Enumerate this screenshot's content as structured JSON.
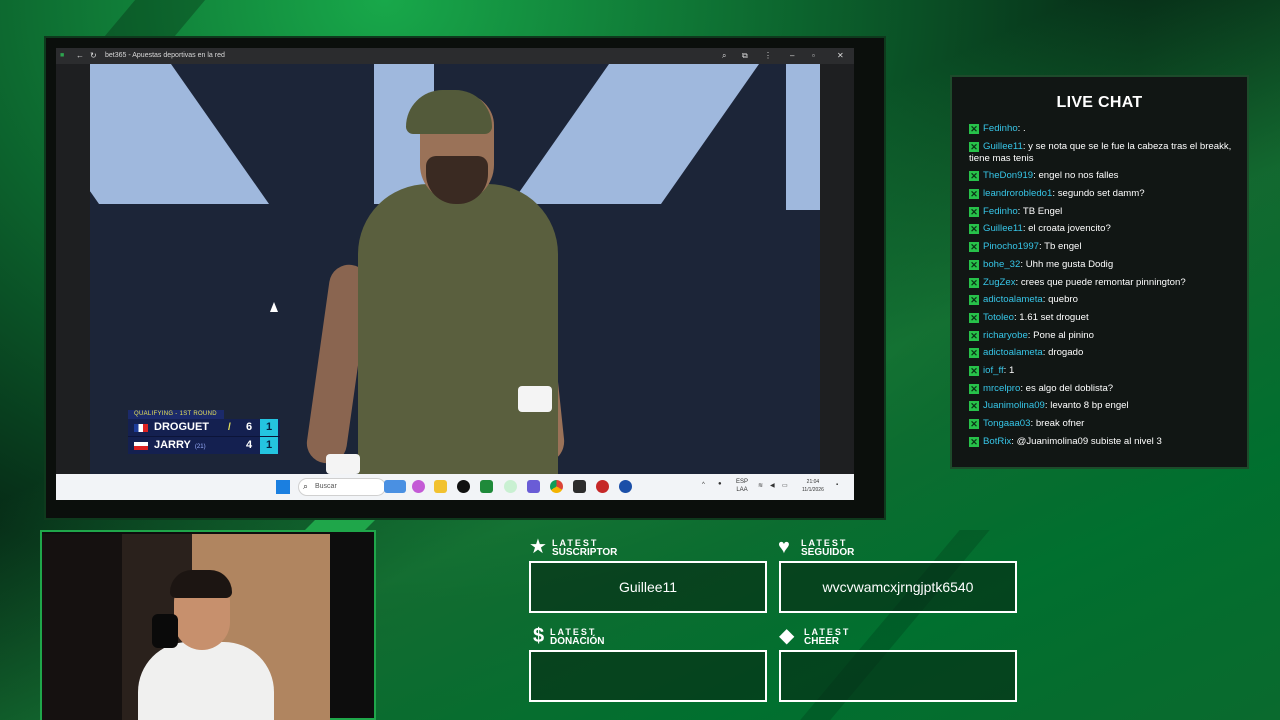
{
  "browser": {
    "tab_title": "bet365 - Apuestas deportivas en la red"
  },
  "scoreboard": {
    "round": "QUALIFYING - 1ST ROUND",
    "players": [
      {
        "name": "DROGUET",
        "rank": "",
        "games": "6",
        "sets": "1",
        "serving": true
      },
      {
        "name": "JARRY",
        "rank": "(21)",
        "games": "4",
        "sets": "1",
        "serving": false
      }
    ]
  },
  "taskbar": {
    "search_placeholder": "Buscar",
    "lang_top": "ESP",
    "lang_bottom": "LAA",
    "time": "21:04",
    "date": "11/1/2026"
  },
  "chat": {
    "title": "LIVE CHAT",
    "messages": [
      {
        "user": "Fedinho",
        "text": ": ."
      },
      {
        "user": "Guillee11",
        "text": ": y se nota que se le fue la cabeza tras el breakk, tiene mas tenis"
      },
      {
        "user": "TheDon919",
        "text": ": engel no nos falles"
      },
      {
        "user": "leandrorobledo1",
        "text": ": segundo set damm?"
      },
      {
        "user": "Fedinho",
        "text": ": TB Engel"
      },
      {
        "user": "Guillee11",
        "text": ": el croata jovencito?"
      },
      {
        "user": "Pinocho1997",
        "text": ": Tb engel"
      },
      {
        "user": "bohe_32",
        "text": ": Uhh me gusta Dodig"
      },
      {
        "user": "ZugZex",
        "text": ": crees que puede remontar pinnington?"
      },
      {
        "user": "adictoalameta",
        "text": ": quebro"
      },
      {
        "user": "Totoleo",
        "text": ": 1.61 set droguet"
      },
      {
        "user": "richaryobe",
        "text": ": Pone al pinino"
      },
      {
        "user": "adictoalameta",
        "text": ": drogado"
      },
      {
        "user": "iof_ff",
        "text": ": 1"
      },
      {
        "user": "mrcelpro",
        "text": ": es algo del doblista?"
      },
      {
        "user": "Juanimolina09",
        "text": ": levanto 8 bp engel"
      },
      {
        "user": "Tongaaa03",
        "text": ": break ofner"
      },
      {
        "user": "BotRix",
        "text": ": @Juanimolina09 subiste al nivel 3"
      }
    ]
  },
  "alerts": {
    "suscriptor": {
      "label_top": "LATEST",
      "label_bottom": "SUSCRIPTOR",
      "value": "Guillee11",
      "icon": "star-icon"
    },
    "seguidor": {
      "label_top": "LATEST",
      "label_bottom": "SEGUIDOR",
      "value": "wvcvwamcxjrngjptk6540",
      "icon": "heart-icon"
    },
    "donacion": {
      "label_top": "LATEST",
      "label_bottom": "DONACIÓN",
      "value": "",
      "icon": "dollar-icon"
    },
    "cheer": {
      "label_top": "LATEST",
      "label_bottom": "CHEER",
      "value": "",
      "icon": "diamond-icon"
    }
  },
  "colors": {
    "accent_green": "#27c24a",
    "username_blue": "#37c6e8",
    "score_set_cyan": "#24c4e0"
  }
}
